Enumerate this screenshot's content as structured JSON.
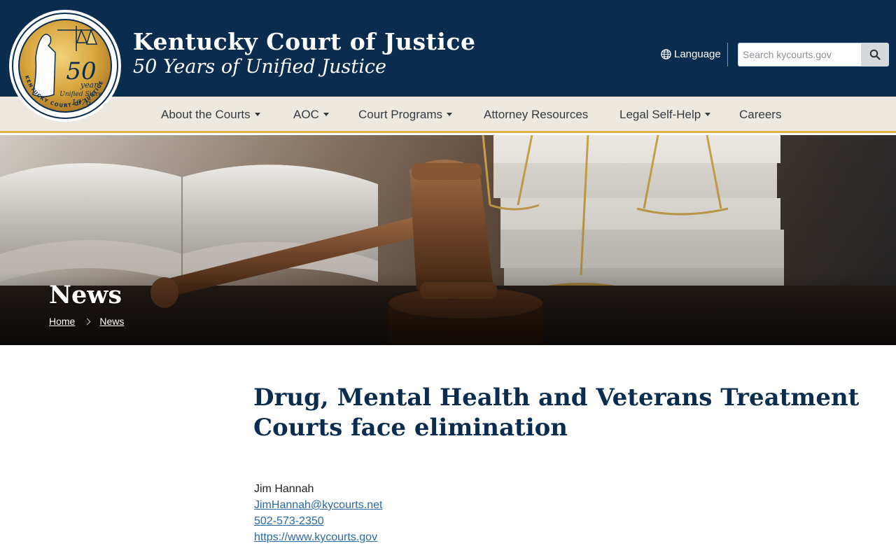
{
  "header": {
    "title": "Kentucky Court of Justice",
    "tagline": "50 Years of Unified Justice",
    "language_label": "Language",
    "search_placeholder": "Search kycourts.gov"
  },
  "seal": {
    "number": "50",
    "years": "years",
    "unified_since": "Unified Since",
    "year": "1976",
    "ring_text": "KENTUCKY COURT OF JUSTICE"
  },
  "nav": {
    "items": [
      {
        "label": "About the Courts",
        "dropdown": true
      },
      {
        "label": "AOC",
        "dropdown": true
      },
      {
        "label": "Court Programs",
        "dropdown": true
      },
      {
        "label": "Attorney Resources",
        "dropdown": false
      },
      {
        "label": "Legal Self-Help",
        "dropdown": true
      },
      {
        "label": "Careers",
        "dropdown": false
      }
    ]
  },
  "hero": {
    "title": "News",
    "breadcrumb": [
      "Home",
      "News"
    ]
  },
  "article": {
    "title": "Drug, Mental Health and Veterans Treatment Courts face elimination",
    "contact_name": "Jim Hannah",
    "contact_email": "JimHannah@kycourts.net",
    "contact_phone": "502-573-2350",
    "contact_url": "https://www.kycourts.gov"
  },
  "colors": {
    "header_bg": "#0a2d4f",
    "nav_bg": "#ede8e0",
    "nav_border": "#e2b33f",
    "title_color": "#0a2d4f",
    "link_color": "#2d6aa3"
  }
}
